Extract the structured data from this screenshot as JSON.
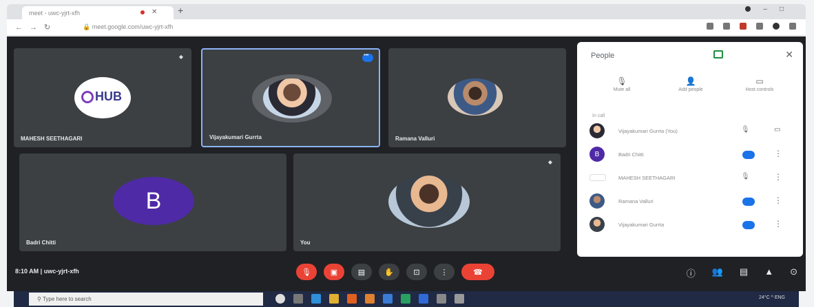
{
  "browser": {
    "tab_title": "meet - uwc-yjrt-xfh",
    "url": "meet.google.com/uwc-yjrt-xfh"
  },
  "tiles": [
    {
      "name": "MAHESH SEETHAGARI"
    },
    {
      "name": "Vijayakumari Gurrta"
    },
    {
      "name": "Ramana Valluri"
    },
    {
      "name": "Badri Chitti",
      "initial": "B"
    },
    {
      "name": "You"
    }
  ],
  "logo": {
    "text": "HUB"
  },
  "panel": {
    "title": "People",
    "actions": [
      {
        "icon": "mic-off-icon",
        "label": "Mute all"
      },
      {
        "icon": "add-person-icon",
        "label": "Add people"
      },
      {
        "icon": "host-controls-icon",
        "label": "Host controls"
      }
    ],
    "section_label": "In call",
    "participants": [
      {
        "name": "Vijayakumari Gurrta (You)",
        "status": "muted"
      },
      {
        "name": "Badri Chitti",
        "status": "speaking",
        "initial": "B"
      },
      {
        "name": "MAHESH SEETHAGARI",
        "status": "muted"
      },
      {
        "name": "Ramana Valluri",
        "status": "speaking"
      },
      {
        "name": "Vijayakumari Gurrta",
        "status": "speaking"
      }
    ]
  },
  "bottom": {
    "time_code": "8:10 AM  |  uwc-yjrt-xfh"
  },
  "taskbar": {
    "search_placeholder": "Type here to search",
    "tray": "24°C  ^  ENG"
  },
  "colors": {
    "meet_bg": "#202124",
    "tile_bg": "#3c4043",
    "accent": "#1a73e8",
    "end_call": "#ea4335",
    "avatar_purple": "#4f2aa6"
  }
}
